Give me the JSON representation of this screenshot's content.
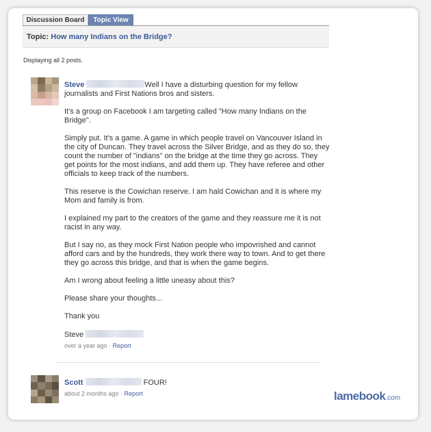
{
  "tabs": {
    "discussion_board": "Discussion Board",
    "topic_view": "Topic View"
  },
  "topic": {
    "label": "Topic:",
    "title": "How many Indians on the Bridge?"
  },
  "displaying": "Displaying all 2 posts.",
  "posts": [
    {
      "author": "Steve",
      "paragraphs": [
        "Well I have a disturbing question for my fellow journalists and First Nations bros and sisters.",
        "It's a group on Facebook I am targeting called \"How many Indians on the Bridge\".",
        "Simply put. It's a game. A game in which people travel on Vancouver Island in the city of Duncan. They travel across the Silver Bridge, and as they do so, they count the number of \"indians\" on the bridge at the time they go across. They get points for the most indians, and add them up. They have referee and other officials to keep track of the numbers.",
        "This reserve is the Cowichan reserve. I am hald Cowichan and it is where my Mom and family is from.",
        "I explained my part to the creators of the game and they reassure me it is not racist in any way.",
        "But I say no, as they mock First Nation people who impovrished and cannot afford cars and by the hundreds, they work there way to town. And to get there they go across this bridge, and that is when the game begins.",
        "Am I wrong about feeling a little uneasy about this?",
        "Please share your thoughts...",
        "Thank you"
      ],
      "signature": "Steve",
      "time": "over a year ago",
      "separator": "·",
      "report": "Report"
    },
    {
      "author": "Scott",
      "text": "FOUR!",
      "time": "about 2 months ago",
      "separator": "·",
      "report": "Report"
    }
  ],
  "brand": {
    "name": "lamebook",
    "suffix": ".com"
  },
  "colors": {
    "link": "#3b5998",
    "tab_active": "#6d84b4",
    "brand": "#4d6aa5"
  }
}
